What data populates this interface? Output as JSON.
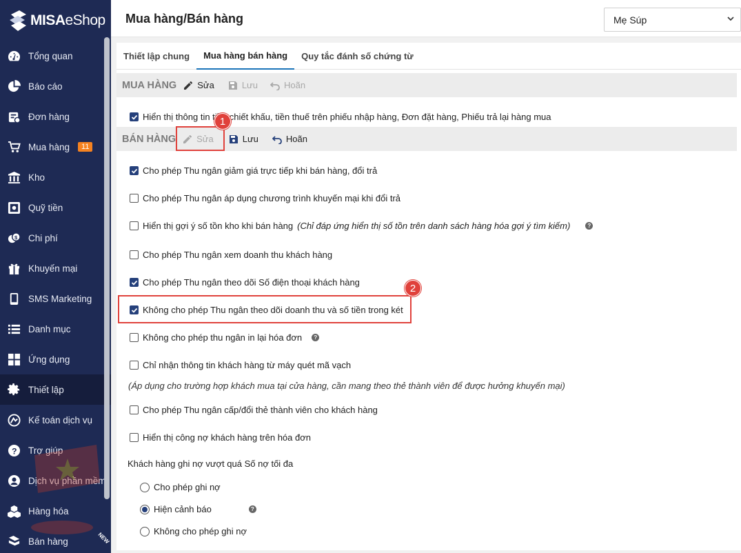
{
  "app": {
    "logo_brand": "MISA",
    "logo_product": "eShop"
  },
  "sidebar": {
    "items": [
      {
        "label": "Tổng quan",
        "icon": "dashboard-icon"
      },
      {
        "label": "Báo cáo",
        "icon": "pie-chart-icon"
      },
      {
        "label": "Đơn hàng",
        "icon": "order-icon"
      },
      {
        "label": "Mua hàng",
        "icon": "cart-icon",
        "badge": "11"
      },
      {
        "label": "Kho",
        "icon": "warehouse-icon"
      },
      {
        "label": "Quỹ tiền",
        "icon": "safe-icon"
      },
      {
        "label": "Chi phí",
        "icon": "money-icon"
      },
      {
        "label": "Khuyến mại",
        "icon": "gift-icon"
      },
      {
        "label": "SMS Marketing",
        "icon": "phone-icon"
      },
      {
        "label": "Danh mục",
        "icon": "list-icon"
      },
      {
        "label": "Ứng dụng",
        "icon": "apps-icon"
      },
      {
        "label": "Thiết lập",
        "icon": "gear-icon",
        "active": true
      },
      {
        "label": "Kế toán dịch vụ",
        "icon": "accounting-icon"
      },
      {
        "label": "Trợ giúp",
        "icon": "help-icon"
      },
      {
        "label": "Dịch vụ phần mềm",
        "icon": "user-circle-icon"
      },
      {
        "label": "Hàng hóa",
        "icon": "boxes-icon"
      },
      {
        "label": "Bán hàng",
        "icon": "sales-icon"
      }
    ],
    "new_tag": "NEW"
  },
  "header": {
    "title": "Mua hàng/Bán hàng",
    "store": "Mẹ Súp"
  },
  "tabs": [
    {
      "label": "Thiết lập chung",
      "active": false
    },
    {
      "label": "Mua hàng bán hàng",
      "active": true
    },
    {
      "label": "Quy tắc đánh số chứng từ",
      "active": false
    }
  ],
  "purchase": {
    "title": "MUA HÀNG",
    "edit": "Sửa",
    "save": "Lưu",
    "undo": "Hoãn",
    "option": "Hiển thị thông tin tiền chiết khấu, tiền thuế trên phiếu nhập hàng, Đơn đặt hàng, Phiếu trả lại hàng mua"
  },
  "sales": {
    "title": "BÁN HÀNG",
    "edit": "Sửa",
    "save": "Lưu",
    "undo": "Hoãn",
    "options": [
      {
        "label": "Cho phép Thu ngân giảm giá trực tiếp khi bán hàng, đổi trả",
        "checked": true
      },
      {
        "label": "Cho phép Thu ngân áp dụng chương trình khuyến mại khi đổi trả",
        "checked": false
      },
      {
        "label": "Hiển thị gợi ý số tồn kho khi bán hàng",
        "note": "(Chỉ đáp ứng hiển thị số tồn trên danh sách hàng hóa gợi ý tìm kiếm)",
        "checked": false
      },
      {
        "label": "Cho phép Thu ngân xem doanh thu khách hàng",
        "checked": false
      },
      {
        "label": "Cho phép Thu ngân theo dõi Số điện thoại khách hàng",
        "checked": true
      },
      {
        "label": "Không cho phép Thu ngân theo dõi doanh thu và số tiền trong két",
        "checked": true
      },
      {
        "label": "Không cho phép thu ngân in lại hóa đơn",
        "checked": false
      },
      {
        "label": "Chỉ nhận thông tin khách hàng từ máy quét mã vạch",
        "checked": false
      },
      {
        "label": "Cho phép Thu ngân cấp/đổi thẻ thành viên cho khách hàng",
        "checked": false
      },
      {
        "label": "Hiển thị công nợ khách hàng trên hóa đơn",
        "checked": false
      }
    ],
    "barcode_note": "(Áp dụng cho trường hợp khách mua tại cửa hàng, cần mang theo thẻ thành viên để được hưởng khuyến mại)",
    "debt_label": "Khách hàng ghi nợ vượt quá Số nợ tối đa",
    "debt_options": [
      {
        "label": "Cho phép ghi nợ",
        "checked": false
      },
      {
        "label": "Hiện cảnh báo",
        "checked": true
      },
      {
        "label": "Không cho phép ghi nợ",
        "checked": false
      }
    ]
  },
  "annotations": {
    "marker1": "1",
    "marker2": "2",
    "color": "#e0413b"
  },
  "colors": {
    "sidebar_bg": "#1e2a54",
    "accent": "#25407b",
    "badge": "#f58220"
  }
}
